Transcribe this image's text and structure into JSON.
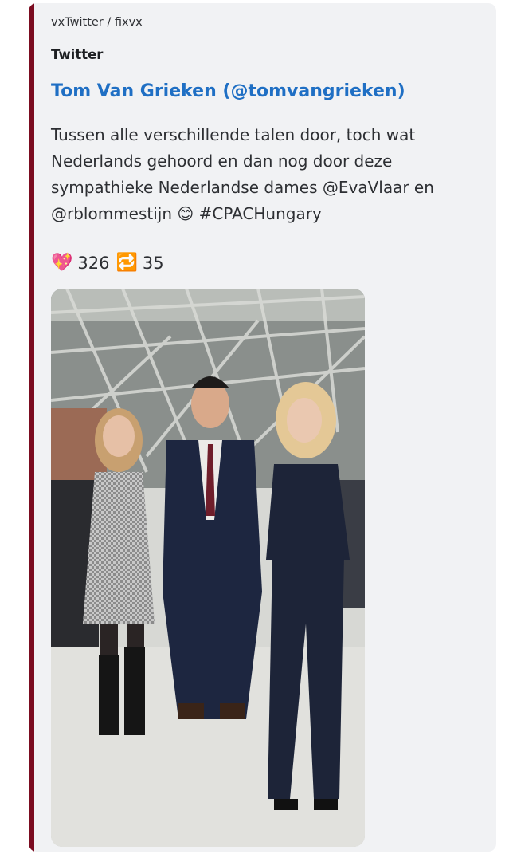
{
  "embed": {
    "provider": "vxTwitter / fixvx",
    "author": "Twitter",
    "title": "Tom Van Grieken (@tomvangrieken)",
    "description": "Tussen alle verschillende talen door, toch wat Nederlands gehoord en dan nog door deze sympathieke Nederlandse dames  @EvaVlaar en @rblommestijn 😊 #CPACHungary",
    "accent_color": "#7b0c20",
    "stats": {
      "likes_emoji": "💖",
      "likes": "326",
      "retweets_emoji": "🔁",
      "retweets": "35"
    },
    "image": {
      "subject": "three people posing at a conference hall"
    }
  }
}
